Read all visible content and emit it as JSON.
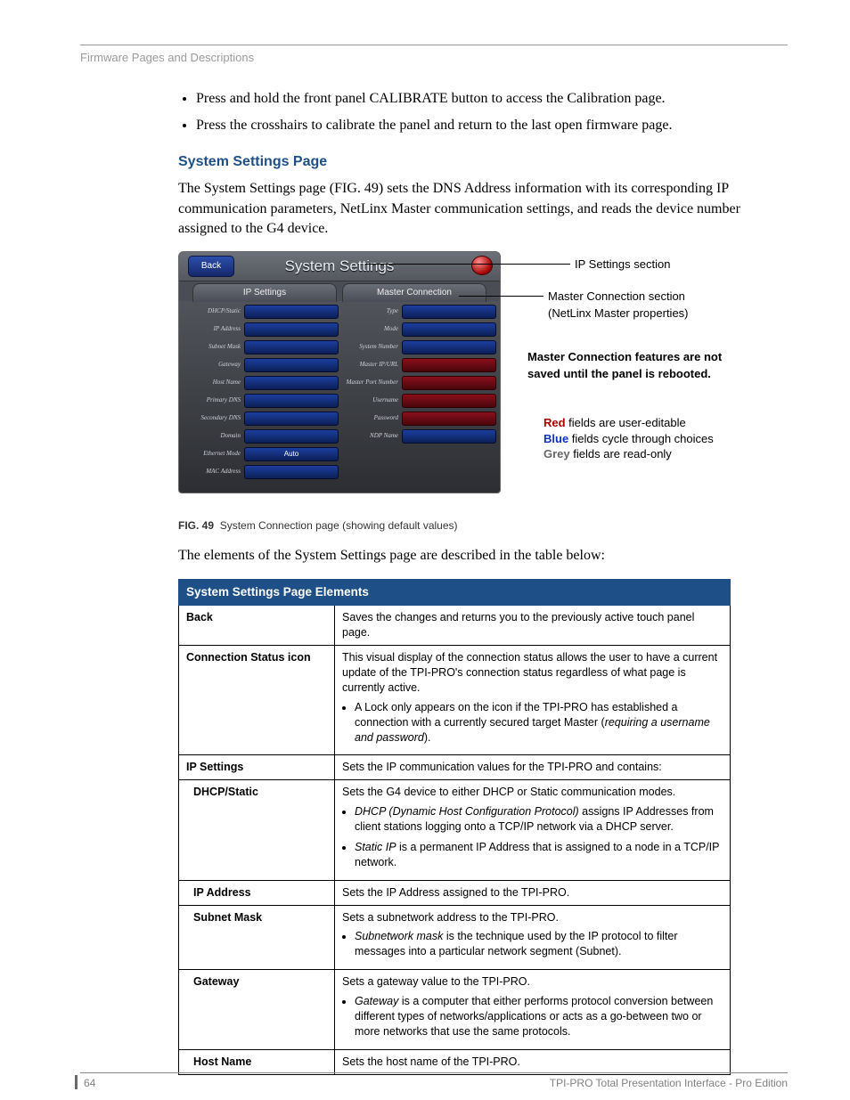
{
  "header": "Firmware Pages and Descriptions",
  "bullets": [
    "Press and hold the front panel CALIBRATE button to access the Calibration page.",
    "Press the crosshairs to calibrate the panel and return to the last open firmware page."
  ],
  "section_title": "System Settings Page",
  "intro_para": "The System Settings page (FIG. 49) sets the DNS Address information with its corresponding IP communication parameters, NetLinx Master communication settings, and reads the device number assigned to the G4 device.",
  "screenshot": {
    "back_label": "Back",
    "title": "System Settings",
    "tab_left": "IP Settings",
    "tab_right": "Master Connection",
    "left_rows": [
      "DHCP/Static",
      "IP Address",
      "Subnet Mask",
      "Gateway",
      "Host Name",
      "Primary DNS",
      "Secondary DNS",
      "Domain",
      "Ethernet Mode",
      "MAC Address"
    ],
    "left_auto_value": "Auto",
    "right_rows": [
      "Type",
      "Mode",
      "System Number",
      "Master IP/URL",
      "Master Port Number",
      "Username",
      "Password",
      "NDP Name"
    ]
  },
  "callouts": {
    "c1": "IP Settings section",
    "c2": "Master Connection section",
    "c2b": "(NetLinx Master properties)",
    "note_bold": "Master Connection features are not saved until the panel is rebooted",
    "legend_red_pre": "Red",
    "legend_red_post": " fields are user-editable",
    "legend_blue_pre": "Blue",
    "legend_blue_post": " fields cycle through choices",
    "legend_grey_pre": "Grey",
    "legend_grey_post": " fields are read-only"
  },
  "fig_caption_bold": "FIG. 49",
  "fig_caption_rest": "System Connection page (showing default values)",
  "post_fig_para": "The elements of the System Settings page are described in the table below:",
  "table": {
    "header": "System Settings Page Elements",
    "rows": [
      {
        "k": "Back",
        "v": "Saves the changes and returns you to the previously active touch panel page."
      },
      {
        "k": "Connection Status icon",
        "v": "This visual display of the connection status allows the user to have a current update of the TPI-PRO's connection status regardless of what page is currently active.",
        "sub": [
          "A Lock only appears on the icon if the TPI-PRO has established a connection with a currently secured target Master (<em>requiring a username and password</em>)."
        ]
      },
      {
        "k": "IP Settings",
        "v": "Sets the IP communication values for the TPI-PRO and contains:"
      },
      {
        "k": "DHCP/Static",
        "indent": true,
        "v": "Sets the G4 device to either DHCP or Static communication modes.",
        "sub": [
          "<em>DHCP (Dynamic Host Configuration Protocol)</em> assigns IP Addresses from client stations logging onto a TCP/IP network via a DHCP server.",
          "<em>Static IP</em> is a permanent IP Address that is assigned to a node in a TCP/IP network."
        ]
      },
      {
        "k": "IP Address",
        "indent": true,
        "v": "Sets the IP Address assigned to the TPI-PRO."
      },
      {
        "k": "Subnet Mask",
        "indent": true,
        "v": "Sets a subnetwork address to the TPI-PRO.",
        "sub": [
          "<em>Subnetwork mask</em> is the technique used by the IP protocol to filter messages into a particular network segment (Subnet)."
        ]
      },
      {
        "k": "Gateway",
        "indent": true,
        "v": "Sets a gateway value to the TPI-PRO.",
        "sub": [
          "<em>Gateway</em> is a computer that either performs protocol conversion between different types of networks/applications or acts as a go-between two or more networks that use the same protocols."
        ]
      },
      {
        "k": "Host Name",
        "indent": true,
        "v": "Sets the host name of the TPI-PRO."
      }
    ]
  },
  "footer": {
    "page": "64",
    "text": "TPI-PRO Total Presentation Interface - Pro Edition"
  }
}
